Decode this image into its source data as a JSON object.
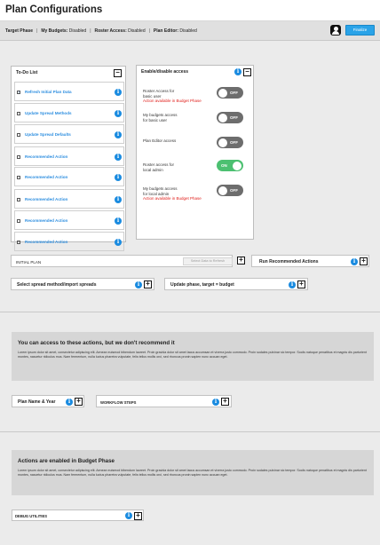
{
  "header": {
    "title": "Plan Configurations"
  },
  "phase_bar": {
    "target_phase": "Target Phase",
    "my_budgets_label": "My Budgets:",
    "my_budgets_value": "Disabled",
    "roster_label": "Roster Access:",
    "roster_value": "Disabled",
    "plan_editor_label": "Plan Editor:",
    "plan_editor_value": "Disabled",
    "separator": "|",
    "finalize_label": "Finalize"
  },
  "todo": {
    "title": "To-Do List",
    "items": [
      {
        "label": "Refresh Initial Plan Data",
        "checked": true
      },
      {
        "label": "Update Spread Methods",
        "checked": false
      },
      {
        "label": "Update Spread Defaults",
        "checked": false
      },
      {
        "label": "Recommended Action",
        "checked": false
      },
      {
        "label": "Recommended Action",
        "checked": false
      },
      {
        "label": "Recommended Action",
        "checked": false
      },
      {
        "label": "Recommended Action",
        "checked": false
      },
      {
        "label": "Recommended Action",
        "checked": false
      }
    ]
  },
  "access": {
    "title": "Enable/disable access",
    "rows": [
      {
        "label_1": "Roster Access for",
        "label_2": "basic user",
        "note": "Action available in Budget Phase",
        "toggle": "OFF"
      },
      {
        "label_1": "My budgets access",
        "label_2": "for basic user",
        "note": "",
        "toggle": "OFF"
      },
      {
        "label_1": "Plan Editor access",
        "label_2": "",
        "note": "",
        "toggle": "OFF"
      },
      {
        "label_1": "Roster access for",
        "label_2": "local admin",
        "note": "",
        "toggle": "ON"
      },
      {
        "label_1": "My budgets access",
        "label_2": "for local admin",
        "note": "Action available in Budget Phase",
        "toggle": "OFF"
      }
    ]
  },
  "initial_plan": {
    "label": "INITIAL PLAN",
    "refresh_placeholder": "Select Data to Refresh"
  },
  "run_recommended": {
    "label": "Run Recommended Actions"
  },
  "spread_method": {
    "label": "Select spread method/import spreads"
  },
  "update_phase": {
    "label": "Update phase, target = budget"
  },
  "section1": {
    "heading": "You can access to these actions, but we don't recommend it",
    "body": "Lorem ipsum dolor sit amet, consectetur adipiscing elit. Aenean euismod bibendum laoreet. Proin gravida dolor sit amet lacus accumsan et viverra justo commodo. Proin sodales pulvinar sic tempor. Sociis natoque penatibus et magnis dis parturient montes, nascetur ridiculus mus. Nam fermentum, nulla luctus pharetra vulputate, felis tellus mollis orci, sed rhoncus pronin sapien nunc accuan eget."
  },
  "plan_name": {
    "label": "Plan Name & Year"
  },
  "workflow": {
    "label": "WORKFLOW STEPS"
  },
  "section2": {
    "heading": "Actions are enabled in Budget Phase",
    "body": "Lorem ipsum dolor sit amet, consectetur adipiscing elit. Aenean euismod bibendum laoreet. Proin gravida dolor sit amet lacus accumsan et viverra justo commodo. Proin sodales pulvinar sic tempor. Sociis natoque penatibus et magnis dis parturient montes, nascetur ridiculus mus. Nam fermentum, nulla luctus pharetra vulputate, felis tellus mollis orci, sed rhoncus pronin sapien nunc accuan eget."
  },
  "debug": {
    "label": "DEBUG UTILITIES"
  },
  "glyphs": {
    "info": "i",
    "minus": "−",
    "plus": "+",
    "check": "✓"
  },
  "colors": {
    "accent": "#2aa3e8",
    "link": "#2f8fe0",
    "info": "#1a8be0",
    "warning": "#e0201c",
    "toggle_on": "#4cc071",
    "toggle_off": "#6d6d6d"
  },
  "icons": [
    "user-avatar-icon",
    "info-icon",
    "collapse-minus-icon",
    "expand-plus-icon",
    "checkbox-icon"
  ]
}
